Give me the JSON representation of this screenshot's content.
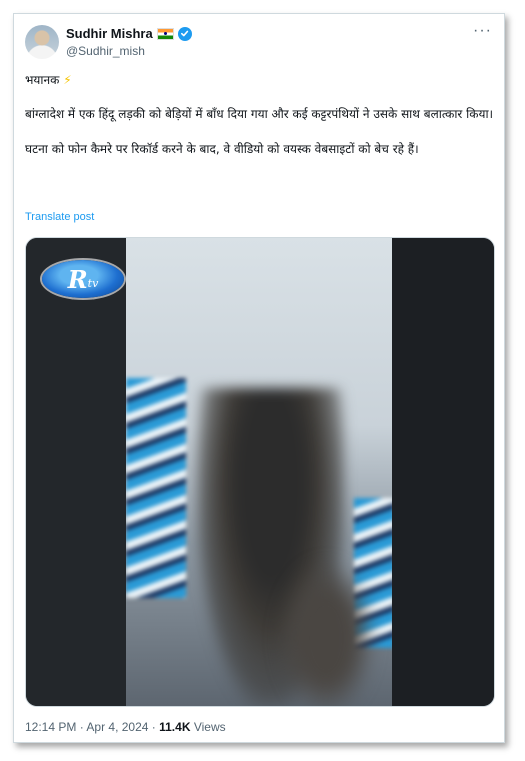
{
  "post": {
    "author_name": "Sudhir Mishra",
    "author_handle": "@Sudhir_mish",
    "more_label": "···",
    "text_line1": "भयानक",
    "text_emoji": "⚡",
    "text_p2": "बांग्लादेश में एक हिंदू लड़की को बेड़ियों में बाँध दिया गया और कई कट्टरपंथियों ने उसके साथ बलात्कार किया।",
    "text_p3": "घटना को फोन कैमरे पर रिकॉर्ड करने के बाद, वे वीडियो को वयस्क वेबसाइटों को बेच रहे हैं।",
    "translate_label": "Translate post",
    "media_logo_r": "R",
    "media_logo_tv": "tv",
    "time": "12:14 PM",
    "dot": "·",
    "date": "Apr 4, 2024",
    "views_count": "11.4K",
    "views_label": "Views"
  },
  "icons": {
    "flag": "india-flag-icon",
    "verified": "verified-badge-icon",
    "more": "more-options-icon"
  },
  "colors": {
    "link": "#1d9bf0",
    "muted": "#536471",
    "text": "#0f1419",
    "verified": "#1d9bf0"
  }
}
